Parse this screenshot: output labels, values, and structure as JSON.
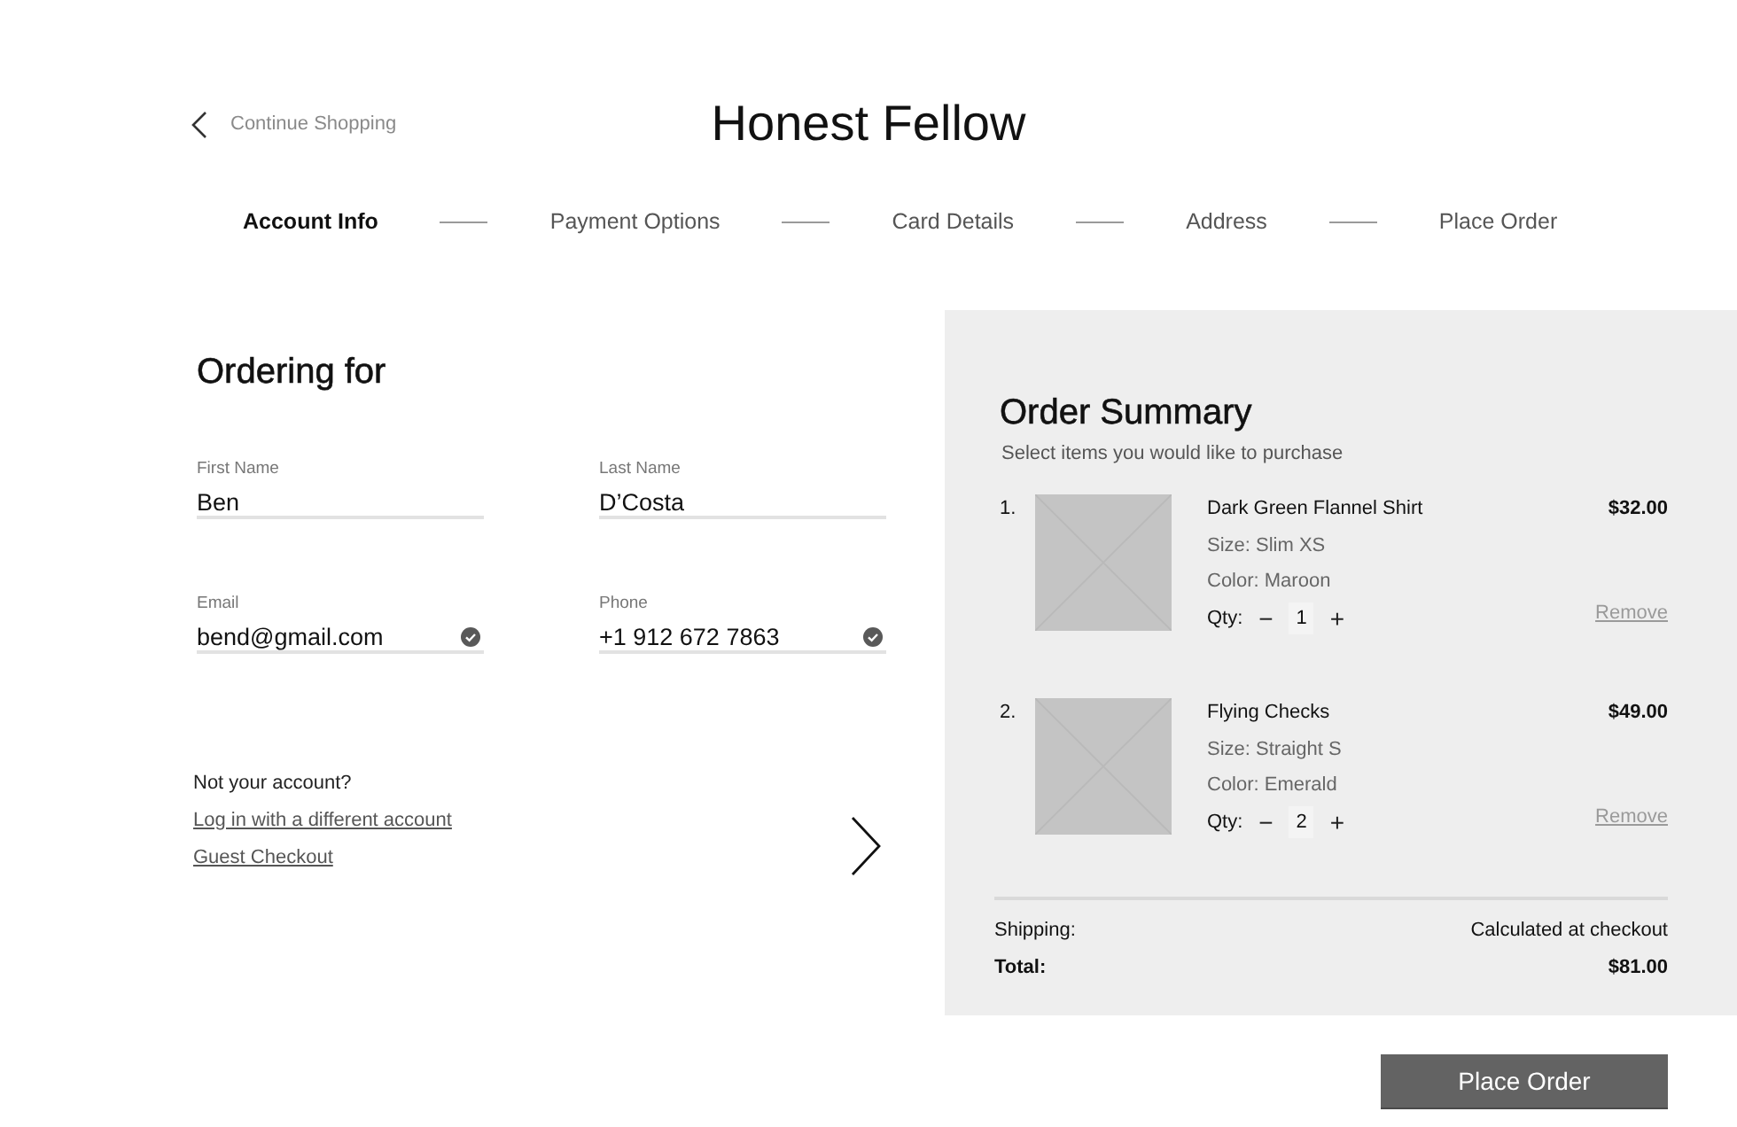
{
  "header": {
    "back_link": "Continue Shopping",
    "title": "Honest Fellow"
  },
  "steps": [
    {
      "label": "Account Info",
      "selected": true
    },
    {
      "label": "Payment Options",
      "selected": false
    },
    {
      "label": "Card Details",
      "selected": false
    },
    {
      "label": "Address",
      "selected": false
    },
    {
      "label": "Place Order",
      "selected": false
    }
  ],
  "ordering": {
    "heading": "Ordering for",
    "fields": [
      {
        "label": "First Name",
        "value": "Ben",
        "verified": false
      },
      {
        "label": "Last Name",
        "value": "D’Costa",
        "verified": false
      },
      {
        "label": "Email",
        "value": "bend@gmail.com",
        "verified": true
      },
      {
        "label": "Phone",
        "value": "+1 912 672 7863",
        "verified": true
      }
    ],
    "account_prompt": "Not your account?",
    "links": [
      "Log in with a different account",
      "Guest Checkout"
    ]
  },
  "order_summary": {
    "heading": "Order Summary",
    "subtitle": "Select items you would like to purchase",
    "items": [
      {
        "number": "1.",
        "name": "Dark Green Flannel Shirt",
        "size": "Size: Slim XS",
        "color_text": "Color: Maroon",
        "qty_label": "Qty:",
        "decrement": "−",
        "quantity": "1",
        "increment": "+",
        "price": "$32.00",
        "remove": "Remove"
      },
      {
        "number": "2.",
        "name": "Flying Checks",
        "size": "Size: Straight S",
        "color_text": "Color: Emerald",
        "qty_label": "Qty:",
        "decrement": "−",
        "quantity": "2",
        "increment": "+",
        "price": "$49.00",
        "remove": "Remove"
      }
    ],
    "shipping_label": "Shipping:",
    "shipping_value": "Calculated at checkout",
    "total_label": "Total:",
    "total_value": "$81.00"
  },
  "place_order_button": "Place Order"
}
